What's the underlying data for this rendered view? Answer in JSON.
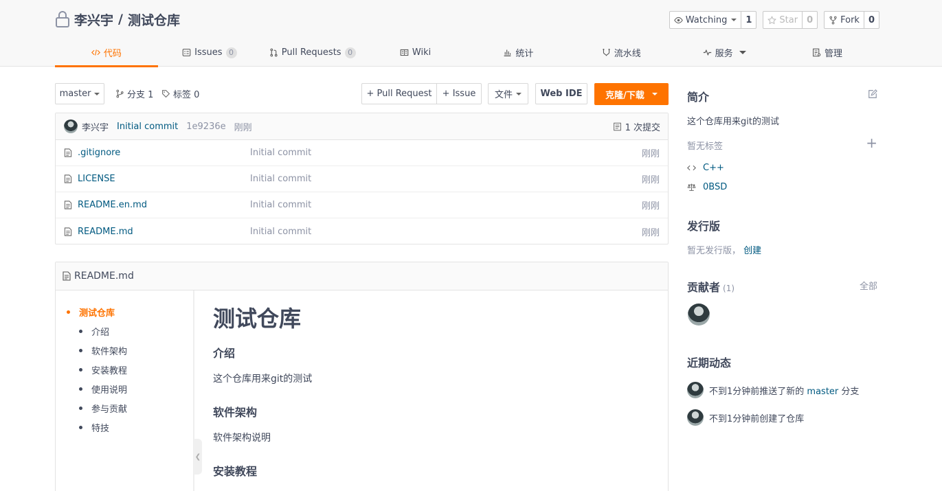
{
  "repo": {
    "owner": "李兴宇",
    "sep": "/",
    "name": "测试仓库"
  },
  "actions": {
    "watch": {
      "label": "Watching",
      "count": "1"
    },
    "star": {
      "label": "Star",
      "count": "0"
    },
    "fork": {
      "label": "Fork",
      "count": "0"
    }
  },
  "tabs": [
    {
      "label": "代码"
    },
    {
      "label": "Issues",
      "badge": "0"
    },
    {
      "label": "Pull Requests",
      "badge": "0"
    },
    {
      "label": "Wiki"
    },
    {
      "label": "统计"
    },
    {
      "label": "流水线"
    },
    {
      "label": "服务"
    },
    {
      "label": "管理"
    }
  ],
  "toolbar": {
    "branch": "master",
    "branches": "分支 1",
    "tags": "标签 0",
    "pull_request": "+ Pull Request",
    "issue": "+ Issue",
    "file": "文件",
    "web_ide": "Web IDE",
    "clone": "克隆/下载"
  },
  "commit": {
    "author": "李兴宇",
    "message": "Initial commit",
    "sha": "1e9236e",
    "time": "刚刚",
    "count": "1 次提交"
  },
  "files": [
    {
      "name": ".gitignore",
      "message": "Initial commit",
      "time": "刚刚"
    },
    {
      "name": "LICENSE",
      "message": "Initial commit",
      "time": "刚刚"
    },
    {
      "name": "README.en.md",
      "message": "Initial commit",
      "time": "刚刚"
    },
    {
      "name": "README.md",
      "message": "Initial commit",
      "time": "刚刚"
    }
  ],
  "readme": {
    "filename": "README.md",
    "toc_title": "测试仓库",
    "toc": [
      "介绍",
      "软件架构",
      "安装教程",
      "使用说明",
      "参与贡献",
      "特技"
    ],
    "h1": "测试仓库",
    "intro_h": "介绍",
    "intro_p": "这个仓库用来git的测试",
    "arch_h": "软件架构",
    "arch_p": "软件架构说明",
    "install_h": "安装教程"
  },
  "sidebar": {
    "about_title": "简介",
    "about_text": "这个仓库用来git的测试",
    "no_tags": "暂无标签",
    "language": "C++",
    "license": "0BSD",
    "release_title": "发行版",
    "release_text": "暂无发行版，",
    "release_create": "创建",
    "contrib_title": "贡献者",
    "contrib_count": "(1)",
    "contrib_all": "全部",
    "activity_title": "近期动态",
    "activity_1_pre": "不到1分钟前推送了新的",
    "activity_1_branch": "master",
    "activity_1_post": "分支",
    "activity_2": "不到1分钟前创建了仓库"
  }
}
